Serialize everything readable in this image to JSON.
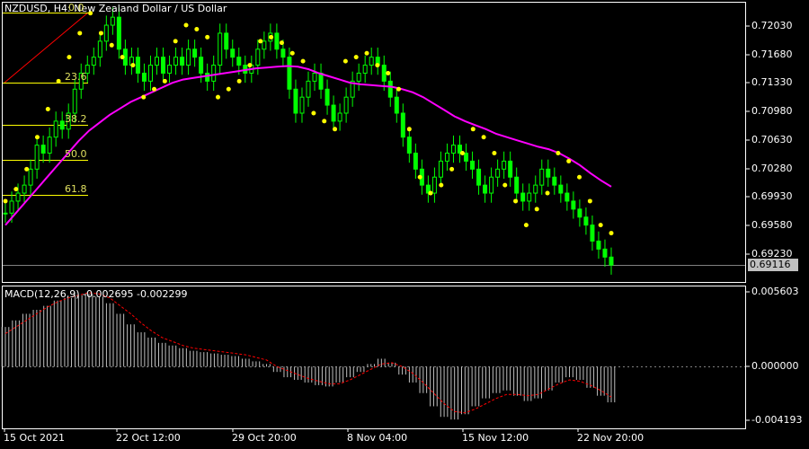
{
  "symbol_title": "NZDUSD, H4:  New Zealand Dollar / US Dollar",
  "macd_title": "MACD(12,26,9) -0.002695 -0.002299",
  "current_price": "0.69116",
  "price_axis": [
    "0.72030",
    "0.71680",
    "0.71330",
    "0.70980",
    "0.70630",
    "0.70280",
    "0.69930",
    "0.69580",
    "0.69230"
  ],
  "macd_axis": [
    "0.005603",
    "0.000000",
    "-0.004193"
  ],
  "time_axis": [
    "15 Oct 2021",
    "22 Oct 12:00",
    "29 Oct 20:00",
    "8 Nov 04:00",
    "15 Nov 12:00",
    "22 Nov 20:00"
  ],
  "fib_levels": [
    "0.0",
    "23.6",
    "38.2",
    "50.0",
    "61.8"
  ],
  "colors": {
    "background": "#000000",
    "candle": "#00ff00",
    "moving_average": "#ff00ff",
    "sar_dots": "#ffff00",
    "fib": "#ffff00",
    "fib_trend": "#ff0000",
    "macd_hist": "#c0c0c0",
    "macd_signal": "#ff0000",
    "grid_border": "#ffffff"
  },
  "chart_data": {
    "type": "line",
    "price_ylim": [
      0.689,
      0.7237
    ],
    "macd_ylim": [
      -0.0046,
      0.006
    ],
    "ohlc_close": [
      0.6975,
      0.699,
      0.7,
      0.701,
      0.703,
      0.706,
      0.705,
      0.707,
      0.709,
      0.708,
      0.71,
      0.713,
      0.715,
      0.716,
      0.717,
      0.719,
      0.721,
      0.722,
      0.718,
      0.716,
      0.717,
      0.715,
      0.714,
      0.716,
      0.717,
      0.715,
      0.716,
      0.717,
      0.716,
      0.718,
      0.717,
      0.715,
      0.714,
      0.716,
      0.72,
      0.718,
      0.717,
      0.716,
      0.715,
      0.716,
      0.718,
      0.719,
      0.72,
      0.718,
      0.717,
      0.713,
      0.71,
      0.712,
      0.714,
      0.715,
      0.713,
      0.711,
      0.709,
      0.71,
      0.712,
      0.714,
      0.715,
      0.716,
      0.717,
      0.716,
      0.714,
      0.712,
      0.71,
      0.707,
      0.705,
      0.703,
      0.701,
      0.7,
      0.702,
      0.704,
      0.705,
      0.706,
      0.705,
      0.704,
      0.703,
      0.701,
      0.7,
      0.702,
      0.703,
      0.704,
      0.702,
      0.7,
      0.699,
      0.7,
      0.701,
      0.703,
      0.702,
      0.701,
      0.7,
      0.699,
      0.698,
      0.697,
      0.696,
      0.694,
      0.693,
      0.692,
      0.691
    ],
    "ma": [
      0.696,
      0.6975,
      0.699,
      0.7005,
      0.702,
      0.7035,
      0.705,
      0.7065,
      0.7078,
      0.7088,
      0.7098,
      0.7106,
      0.7114,
      0.712,
      0.7126,
      0.7132,
      0.7138,
      0.7142,
      0.7144,
      0.7146,
      0.7148,
      0.715,
      0.7152,
      0.7154,
      0.7156,
      0.7157,
      0.7158,
      0.7159,
      0.7158,
      0.7155,
      0.715,
      0.7146,
      0.7142,
      0.7138,
      0.7136,
      0.7135,
      0.7134,
      0.7133,
      0.713,
      0.7126,
      0.712,
      0.7112,
      0.7104,
      0.7096,
      0.709,
      0.7085,
      0.708,
      0.7074,
      0.707,
      0.7066,
      0.7062,
      0.7058,
      0.7055,
      0.705,
      0.7043,
      0.7035,
      0.7025,
      0.7016,
      0.7008
    ],
    "sar": [
      0.699,
      0.7005,
      0.703,
      0.707,
      0.7105,
      0.714,
      0.717,
      0.72,
      0.7225,
      0.72,
      0.7185,
      0.717,
      0.716,
      0.712,
      0.713,
      0.714,
      0.719,
      0.721,
      0.7205,
      0.7195,
      0.712,
      0.713,
      0.714,
      0.716,
      0.719,
      0.7195,
      0.7188,
      0.7175,
      0.7165,
      0.71,
      0.709,
      0.708,
      0.7165,
      0.717,
      0.7175,
      0.716,
      0.715,
      0.713,
      0.708,
      0.702,
      0.7,
      0.701,
      0.703,
      0.705,
      0.708,
      0.707,
      0.705,
      0.701,
      0.699,
      0.696,
      0.698,
      0.7,
      0.705,
      0.704,
      0.702,
      0.699,
      0.696,
      0.695
    ],
    "macd_hist": [
      0.003,
      0.0035,
      0.004,
      0.0043,
      0.0046,
      0.005,
      0.0052,
      0.0054,
      0.0055,
      0.0053,
      0.0048,
      0.004,
      0.0032,
      0.0026,
      0.0022,
      0.0018,
      0.0016,
      0.0014,
      0.0012,
      0.0011,
      0.001,
      0.0009,
      0.0008,
      0.0006,
      0.0004,
      0.0002,
      -0.0004,
      -0.0008,
      -0.001,
      -0.0012,
      -0.0014,
      -0.0015,
      -0.0012,
      -0.0008,
      -0.0004,
      0.0002,
      0.0006,
      0.0003,
      -0.0006,
      -0.0012,
      -0.002,
      -0.003,
      -0.0038,
      -0.004,
      -0.0036,
      -0.003,
      -0.0024,
      -0.002,
      -0.0018,
      -0.0022,
      -0.0026,
      -0.0024,
      -0.0018,
      -0.0012,
      -0.0008,
      -0.001,
      -0.0016,
      -0.0022,
      -0.0027
    ],
    "macd_signal": [
      0.0025,
      0.003,
      0.0035,
      0.004,
      0.0045,
      0.0049,
      0.0052,
      0.0054,
      0.0056,
      0.0055,
      0.0052,
      0.0046,
      0.004,
      0.0033,
      0.0027,
      0.0022,
      0.0019,
      0.0016,
      0.0014,
      0.0013,
      0.0012,
      0.0011,
      0.001,
      0.0009,
      0.0007,
      0.0005,
      0.0,
      -0.0003,
      -0.0006,
      -0.0009,
      -0.0011,
      -0.0013,
      -0.0013,
      -0.001,
      -0.0006,
      -0.0002,
      0.0002,
      0.0003,
      0.0,
      -0.0005,
      -0.0012,
      -0.002,
      -0.0028,
      -0.0034,
      -0.0035,
      -0.0032,
      -0.0028,
      -0.0024,
      -0.0021,
      -0.0021,
      -0.0022,
      -0.0021,
      -0.0017,
      -0.0013,
      -0.001,
      -0.0011,
      -0.0014,
      -0.0018,
      -0.0023
    ]
  }
}
